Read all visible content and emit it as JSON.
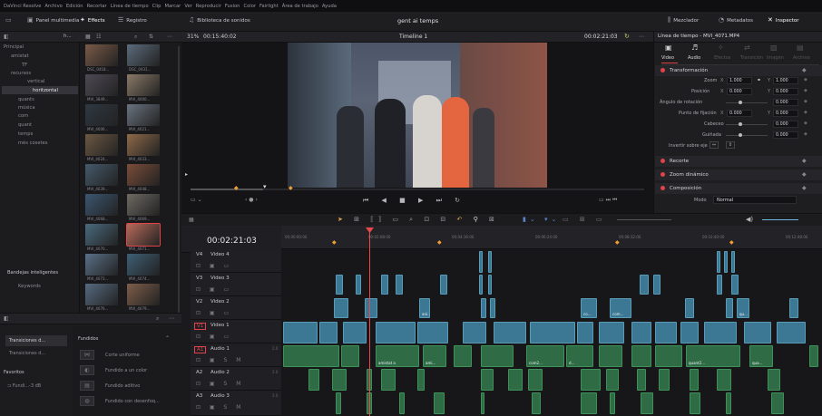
{
  "menu": [
    "DaVinci Resolve",
    "Archivo",
    "Edición",
    "Recortar",
    "Línea de tiempo",
    "Clip",
    "Marcar",
    "Ver",
    "Reproducir",
    "Fusion",
    "Color",
    "Fairlight",
    "Área de trabajo",
    "Ayuda"
  ],
  "toolbar": {
    "media_pool": "Panel multimedia",
    "effects": "Effects",
    "index": "Registro",
    "sound_library": "Biblioteca de sonidos",
    "project_title": "gent ai temps",
    "mixer": "Mezclador",
    "metadata": "Metadatos",
    "inspector": "Inspector"
  },
  "bins": {
    "header": "h...",
    "items": [
      "Principal",
      "amistat",
      "TF",
      "recursos",
      "vertical",
      "horitzontal",
      "quants",
      "música",
      "com",
      "quant",
      "temps",
      "més cosetes"
    ],
    "smart_bins_title": "Bandejas inteligentes",
    "keywords": "Keywords"
  },
  "media": [
    "DSC_0418...",
    "DSC_0431...",
    "MVI_3849...",
    "MVI_4000...",
    "MVI_4006...",
    "MVI_4021...",
    "MVI_4024...",
    "MVI_4033...",
    "MVI_4039...",
    "MVI_4048...",
    "MVI_4068...",
    "MVI_4069...",
    "MVI_4070...",
    "MVI_4071...",
    "MVI_4073...",
    "MVI_4074...",
    "MVI_4076...",
    "MVI_4079..."
  ],
  "viewer": {
    "zoom": "31%",
    "source_tc": "00:15:40:02",
    "timeline_name": "Timeline 1",
    "record_tc": "00:02:21:03"
  },
  "inspector": {
    "title": "Línea de tiempo - MVI_4071.MP4",
    "tabs": [
      "Video",
      "Audio",
      "Efectos",
      "Transición",
      "Imagen",
      "Archivo"
    ],
    "transform": "Transformación",
    "zoom_label": "Zoom",
    "zoom_x": "1.000",
    "zoom_y": "1.000",
    "position_label": "Posición",
    "pos_x": "0.000",
    "pos_y": "0.000",
    "rotation_label": "Ángulo de rotación",
    "rotation": "0.000",
    "anchor_label": "Punto de fijación",
    "anchor_x": "0.000",
    "anchor_y": "0.000",
    "pitch_label": "Cabeceo",
    "pitch": "0.000",
    "yaw_label": "Guiñada",
    "yaw": "0.000",
    "flip_label": "Invertir sobre eje",
    "crop": "Recorte",
    "dynamic_zoom": "Zoom dinámico",
    "composite": "Composición",
    "mode_label": "Modo",
    "mode_value": "Normal"
  },
  "timeline": {
    "timecode": "00:02:21:03",
    "ruler": [
      "00:00:00:00",
      "00:02:08:00",
      "00:04:16:00",
      "00:06:24:00",
      "00:08:32:00",
      "00:10:40:00",
      "00:12:48:00"
    ],
    "tracks": [
      {
        "id": "V4",
        "name": "Video 4"
      },
      {
        "id": "V3",
        "name": "Video 3"
      },
      {
        "id": "V2",
        "name": "Video 2"
      },
      {
        "id": "V1",
        "name": "Video 1"
      },
      {
        "id": "A1",
        "name": "Audio 1",
        "level": "2.0"
      },
      {
        "id": "A2",
        "name": "Audio 2",
        "level": "2.0"
      },
      {
        "id": "A3",
        "name": "Audio 3",
        "level": "2.0"
      }
    ],
    "clip_labels": [
      "ani...",
      "amist...",
      "co...",
      "com...",
      "qu...",
      "quant2...",
      "qua...",
      "amistat a",
      "ami...",
      "com2...",
      "d..."
    ]
  },
  "effects": {
    "left_items": [
      "Transiciones d...",
      "Transiciones d..."
    ],
    "favorites_title": "Favoritos",
    "favorite_item": "Fundi...-3 dB",
    "category": "Fundidos",
    "list": [
      "Corte uniforme",
      "Fundido a un color",
      "Fundido aditivo",
      "Fundido con desenfoq..."
    ]
  },
  "colors": {
    "accent": "#e0434a",
    "playhead": "#e84a4a",
    "video_clip": "#3c7893",
    "audio_clip": "#2f6b45",
    "selected_bin": "#3a3a40"
  }
}
